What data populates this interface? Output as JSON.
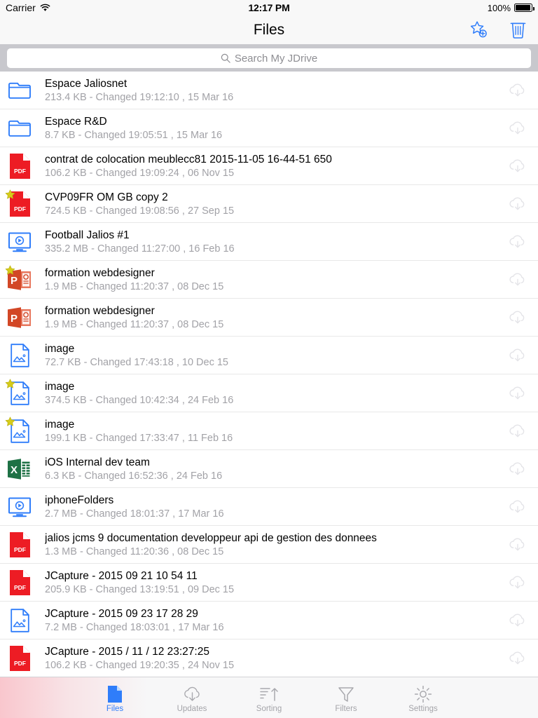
{
  "status_bar": {
    "carrier": "Carrier",
    "wifi_icon": "wifi-icon",
    "time": "12:17 PM",
    "battery_percent": "100%",
    "battery_icon": "battery-full-icon"
  },
  "nav_bar": {
    "title": "Files",
    "actions": [
      {
        "name": "add-favorite-button",
        "icon": "star-plus-icon",
        "color": "#2f7dfa"
      },
      {
        "name": "delete-button",
        "icon": "trash-icon",
        "color": "#2f7dfa"
      }
    ]
  },
  "search": {
    "placeholder": "Search My JDrive",
    "value": "",
    "icon": "search-icon"
  },
  "colors": {
    "accent": "#2f7dfa",
    "pdf_red": "#ed1c24",
    "ppt_orange": "#d24726",
    "excel_green": "#1e7145",
    "star_yellow": "#d6cc19",
    "meta_gray": "#a2a2a7",
    "search_bg": "#c8c8cd"
  },
  "files": [
    {
      "name": "Espace Jaliosnet",
      "meta": "213.4 KB - Changed 19:12:10 , 15 Mar 16",
      "type": "folder",
      "starred": false,
      "download_icon": "cloud-download-icon"
    },
    {
      "name": "Espace R&D",
      "meta": "8.7 KB - Changed 19:05:51 , 15 Mar 16",
      "type": "folder",
      "starred": false,
      "download_icon": "cloud-download-icon"
    },
    {
      "name": "contrat de colocation meublecc81 2015-11-05 16-44-51 650",
      "meta": "106.2 KB - Changed 19:09:24 , 06 Nov 15",
      "type": "pdf",
      "starred": false,
      "download_icon": "cloud-download-icon"
    },
    {
      "name": "CVP09FR OM GB copy 2",
      "meta": "724.5 KB - Changed 19:08:56 , 27 Sep 15",
      "type": "pdf",
      "starred": true,
      "download_icon": "cloud-download-icon"
    },
    {
      "name": "Football Jalios #1",
      "meta": "335.2 MB - Changed 11:27:00 , 16 Feb 16",
      "type": "video",
      "starred": false,
      "download_icon": "cloud-download-icon"
    },
    {
      "name": "formation webdesigner",
      "meta": "1.9 MB - Changed 11:20:37 , 08 Dec 15",
      "type": "powerpoint",
      "starred": true,
      "download_icon": "cloud-download-icon"
    },
    {
      "name": "formation webdesigner",
      "meta": "1.9 MB - Changed 11:20:37 , 08 Dec 15",
      "type": "powerpoint",
      "starred": false,
      "download_icon": "cloud-download-icon"
    },
    {
      "name": "image",
      "meta": "72.7 KB - Changed 17:43:18 , 10 Dec 15",
      "type": "image",
      "starred": false,
      "download_icon": "cloud-download-icon"
    },
    {
      "name": "image",
      "meta": "374.5 KB - Changed 10:42:34 , 24 Feb 16",
      "type": "image",
      "starred": true,
      "download_icon": "cloud-download-icon"
    },
    {
      "name": "image",
      "meta": "199.1 KB - Changed 17:33:47 , 11 Feb 16",
      "type": "image",
      "starred": true,
      "download_icon": "cloud-download-icon"
    },
    {
      "name": "iOS Internal dev team",
      "meta": "6.3 KB - Changed 16:52:36 , 24 Feb 16",
      "type": "excel",
      "starred": false,
      "download_icon": "cloud-download-icon"
    },
    {
      "name": "iphoneFolders",
      "meta": "2.7 MB - Changed 18:01:37 , 17 Mar 16",
      "type": "video",
      "starred": false,
      "download_icon": "cloud-download-icon"
    },
    {
      "name": "jalios jcms 9 documentation developpeur api de gestion des donnees",
      "meta": "1.3 MB - Changed 11:20:36 , 08 Dec 15",
      "type": "pdf",
      "starred": false,
      "download_icon": "cloud-download-icon"
    },
    {
      "name": "JCapture -   2015 09 21 10 54 11",
      "meta": "205.9 KB - Changed 13:19:51 , 09 Dec 15",
      "type": "pdf",
      "starred": false,
      "download_icon": "cloud-download-icon"
    },
    {
      "name": "JCapture -   2015 09 23 17 28 29",
      "meta": "7.2 MB - Changed 18:03:01 , 17 Mar 16",
      "type": "image",
      "starred": false,
      "download_icon": "cloud-download-icon"
    },
    {
      "name": "JCapture -   2015 / 11 / 12 23:27:25",
      "meta": "106.2 KB - Changed 19:20:35 , 24 Nov 15",
      "type": "pdf",
      "starred": false,
      "download_icon": "cloud-download-icon"
    }
  ],
  "tab_bar": {
    "active": "Files",
    "tabs": [
      {
        "label": "Files",
        "icon": "file-icon",
        "active": true
      },
      {
        "label": "Updates",
        "icon": "cloud-download-icon",
        "active": false
      },
      {
        "label": "Sorting",
        "icon": "sort-ascending-icon",
        "active": false
      },
      {
        "label": "Filters",
        "icon": "funnel-icon",
        "active": false
      },
      {
        "label": "Settings",
        "icon": "gear-icon",
        "active": false
      }
    ]
  }
}
